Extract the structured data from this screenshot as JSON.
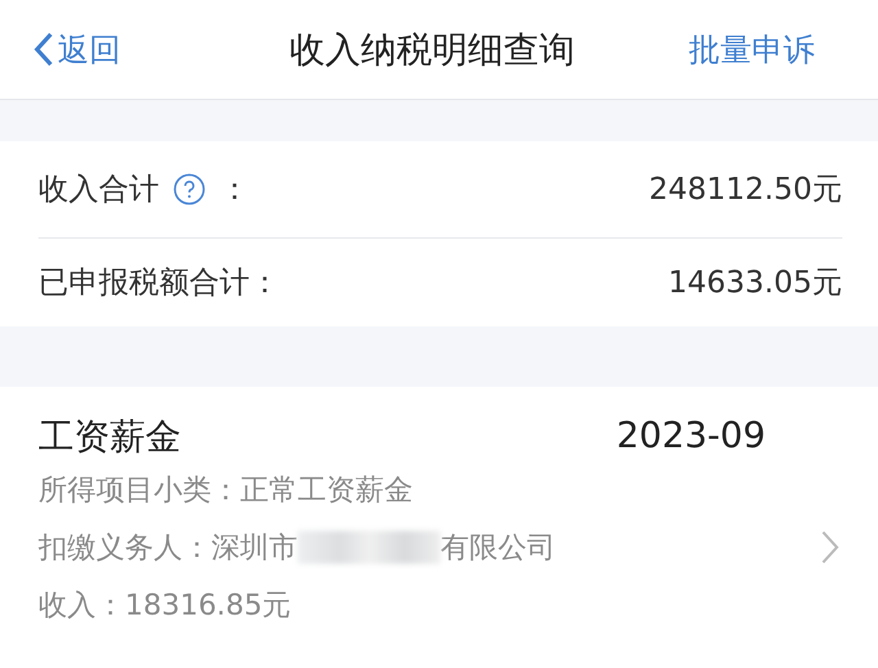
{
  "nav": {
    "back": "返回",
    "title": "收入纳税明细查询",
    "action": "批量申诉"
  },
  "summary": [
    {
      "label": "收入合计",
      "help": true,
      "colon": "：",
      "value": "248112.50元"
    },
    {
      "label": "已申报税额合计：",
      "help": false,
      "value": "14633.05元"
    }
  ],
  "records": [
    {
      "title": "工资薪金",
      "period": "2023-09",
      "subtype": "所得项目小类：正常工资薪金",
      "payer_label": "扣缴义务人：",
      "payer_start": "深圳市",
      "payer_end": "有限公司",
      "redacted": true,
      "income": "收入：18316.85元"
    }
  ]
}
